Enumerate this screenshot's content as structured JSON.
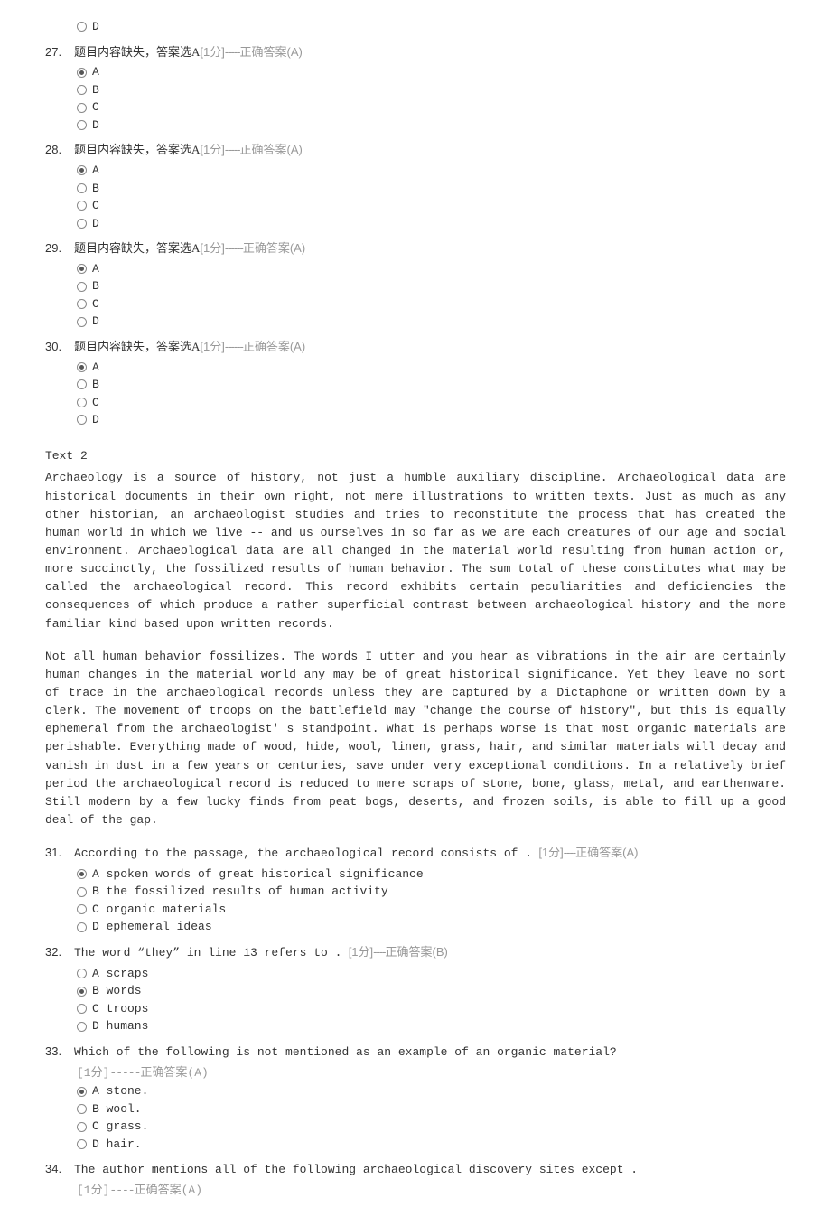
{
  "top_options": {
    "d_label": "D"
  },
  "missing_questions": [
    {
      "num": "27.",
      "text": "题目内容缺失，答案选A",
      "score": "[1分]",
      "dashes": "-----",
      "ans": "正确答案(A)",
      "sel": "A",
      "opts": [
        "A",
        "B",
        "C",
        "D"
      ]
    },
    {
      "num": "28.",
      "text": "题目内容缺失，答案选A",
      "score": "[1分]",
      "dashes": "-----",
      "ans": "正确答案(A)",
      "sel": "A",
      "opts": [
        "A",
        "B",
        "C",
        "D"
      ]
    },
    {
      "num": "29.",
      "text": "题目内容缺失，答案选A",
      "score": "[1分]",
      "dashes": "------",
      "ans": "正确答案(A)",
      "sel": "A",
      "opts": [
        "A",
        "B",
        "C",
        "D"
      ]
    },
    {
      "num": "30.",
      "text": "题目内容缺失，答案选A",
      "score": "[1分]",
      "dashes": "------",
      "ans": "正确答案(A)",
      "sel": "A",
      "opts": [
        "A",
        "B",
        "C",
        "D"
      ]
    }
  ],
  "passage_title": "Text 2",
  "passage_p1": "Archaeology is a source of history, not just a humble auxiliary discipline. Archaeological data are historical documents in their own right, not mere illustrations to written texts. Just as much as any other historian, an archaeologist studies and tries to reconstitute the process that has created the human world in which we live -- and us ourselves in so far as we are each creatures of our age and social environment. Archaeological data are all changed in the material world resulting from human action or, more succinctly, the fossilized results of human behavior. The sum total of these constitutes what may be called the archaeological record. This record exhibits certain peculiarities and deficiencies the consequences of which produce a rather superficial contrast between archaeological history and the more familiar kind based upon written records.",
  "passage_p2": "Not all human behavior fossilizes. The words I utter and you hear as vibrations in the air are certainly human changes in the material world any may be of great historical significance. Yet they leave no sort of trace in the archaeological records unless they are captured by a Dictaphone or written down by a clerk. The movement of troops on the battlefield may \"change the course of history\", but this is equally ephemeral from the archaeologist' s standpoint. What is perhaps worse is that most organic materials are perishable. Everything made of wood, hide, wool, linen, grass, hair, and similar materials will decay and vanish in dust in a few years or centuries, save under very exceptional conditions. In a relatively brief period the archaeological record is reduced to mere scraps of stone, bone, glass, metal, and earthenware. Still modern by a few lucky finds from peat bogs, deserts, and frozen soils, is able to fill up a good deal of the gap.",
  "reading_questions": [
    {
      "num": "31.",
      "text": "According to the passage, the archaeological record consists of .",
      "score": "[1分]",
      "dashes": "----",
      "ans": "正确答案(A)",
      "inline_answer": true,
      "sel": "A",
      "opts": [
        "A spoken words of great historical significance",
        "B the fossilized results of human activity",
        "C organic materials",
        "D ephemeral ideas"
      ]
    },
    {
      "num": "32.",
      "text": "The word “they” in line 13 refers to .",
      "score": "[1分]",
      "dashes": "----",
      "ans": "正确答案(B)",
      "inline_answer": true,
      "sel": "B",
      "opts": [
        "A scraps",
        "B words",
        "C troops",
        "D humans"
      ]
    },
    {
      "num": "33.",
      "text": "Which of the following is not mentioned as an example of an organic material?",
      "score": "[1分]",
      "dashes": "-----",
      "ans": "正确答案(A)",
      "inline_answer": false,
      "sel": "A",
      "opts": [
        "A stone.",
        "B wool.",
        "C grass.",
        "D hair."
      ]
    },
    {
      "num": "34.",
      "text": "The author mentions all of the following archaeological discovery sites except .",
      "score": "[1分]",
      "dashes": "----",
      "ans": "正确答案(A)",
      "inline_answer": false,
      "sel": null,
      "opts": []
    }
  ]
}
